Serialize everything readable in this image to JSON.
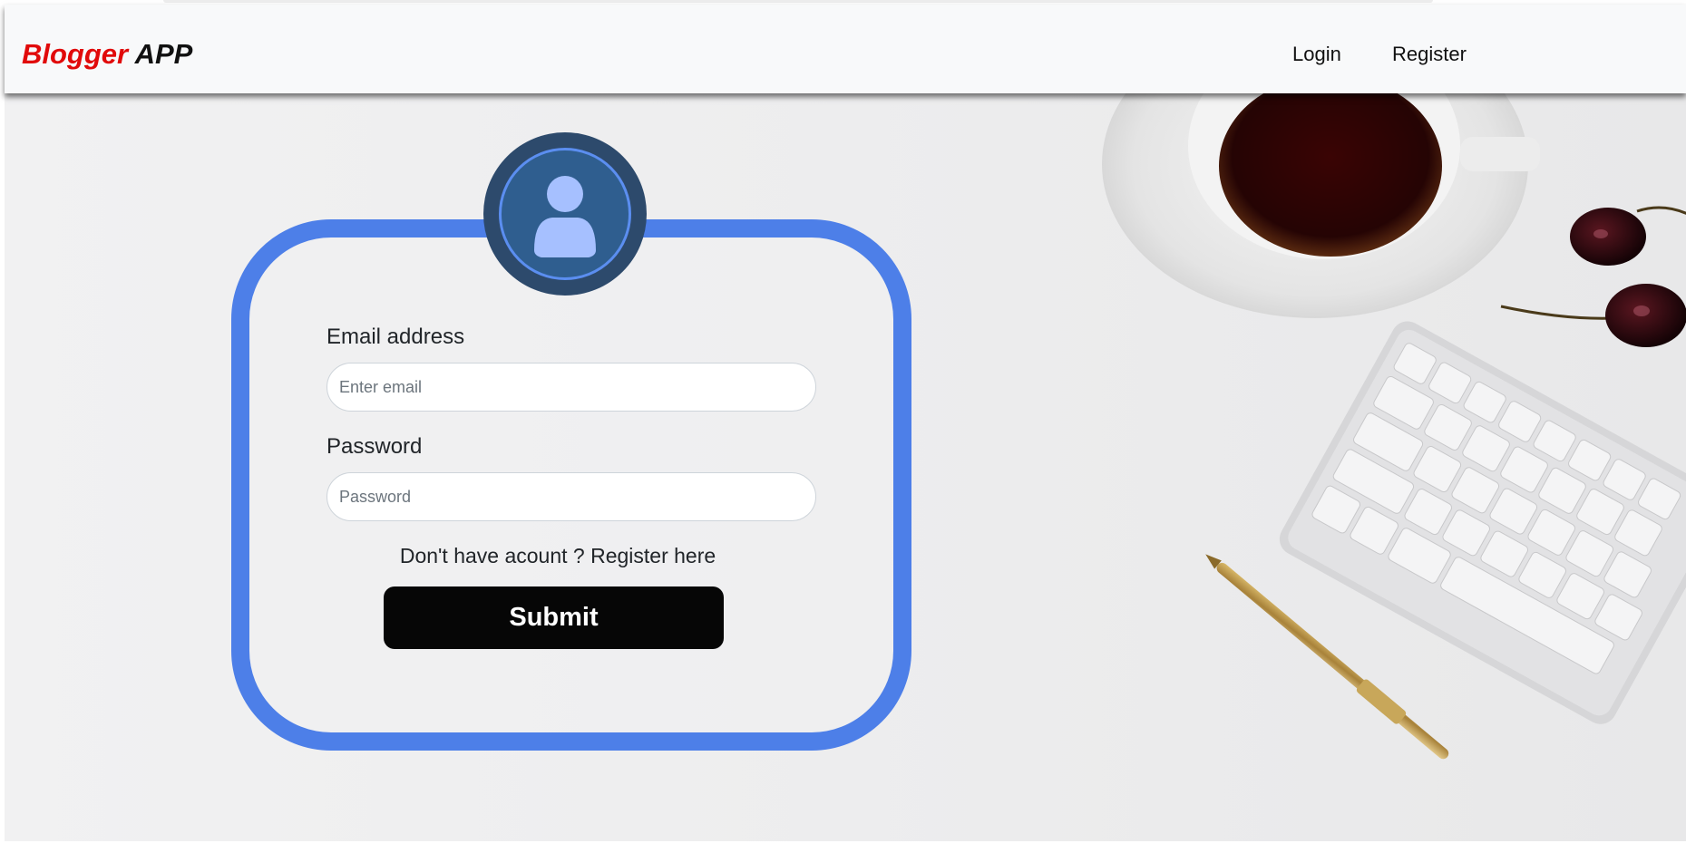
{
  "navbar": {
    "brand_part1": "Blogger",
    "brand_part2": "APP",
    "links": [
      {
        "label": "Login"
      },
      {
        "label": "Register"
      }
    ]
  },
  "form": {
    "email_label": "Email address",
    "email_placeholder": "Enter email",
    "email_value": "",
    "password_label": "Password",
    "password_placeholder": "Password",
    "password_value": "",
    "register_prompt": "Don't have acount ? Register here",
    "submit_label": "Submit"
  },
  "icons": {
    "avatar": "user-avatar-icon"
  },
  "colors": {
    "brand_red": "#e10a0a",
    "card_border": "#4d7fe8",
    "avatar_ring": "#2d4a6c",
    "button_bg": "#060606"
  }
}
